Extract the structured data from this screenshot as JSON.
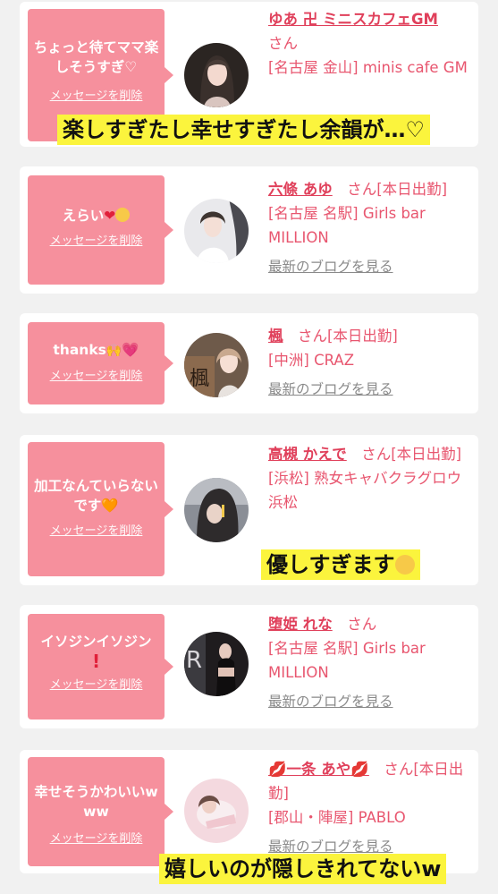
{
  "delete_label": "メッセージを削除",
  "blog_label": "最新のブログを見る",
  "san": "さん",
  "cards": [
    {
      "message": "ちょっと待てママ楽しそうすぎ♡",
      "name": "ゆあ 卍 ミニスカフェGM",
      "status": "",
      "shop": "[名古屋 金山] minis cafe GM",
      "caption": "楽しすぎたし幸せすぎたし余韻が…♡"
    },
    {
      "message": "えらい",
      "name": "六條 あゆ",
      "status": "[本日出勤]",
      "shop": "[名古屋 名駅] Girls bar MILLION"
    },
    {
      "message": "thanks",
      "name": "楓",
      "status": "[本日出勤]",
      "shop": "[中洲] CRAZ"
    },
    {
      "message": "加工なんていらないです",
      "name": "高槻 かえで",
      "status": "[本日出勤]",
      "shop": "[浜松] 熟女キャバクラグロウ 浜松",
      "caption": "優しすぎます"
    },
    {
      "message": "イソジンイソジン",
      "name": "堕姫 れな",
      "status": "",
      "shop": "[名古屋 名駅] Girls bar MILLION"
    },
    {
      "message": "幸せそうかわいいwww",
      "name": "一条 あや",
      "status": "[本日出勤]",
      "shop": "[郡山・陣屋] PABLO",
      "caption": "嬉しいのが隠しきれてないw"
    }
  ]
}
